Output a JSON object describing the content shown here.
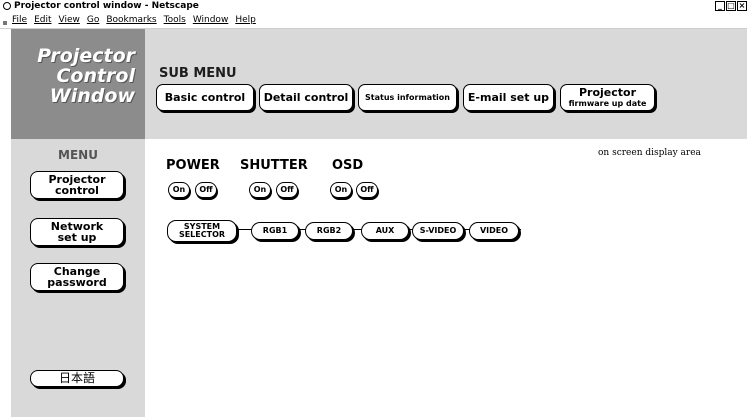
{
  "window": {
    "title": "Projector control window - Netscape",
    "controls": [
      "_",
      "□",
      "×"
    ]
  },
  "menubar": {
    "items": [
      "File",
      "Edit",
      "View",
      "Go",
      "Bookmarks",
      "Tools",
      "Window",
      "Help"
    ]
  },
  "logo": {
    "lines": [
      "Projector",
      "Control",
      "Window"
    ]
  },
  "submenu": {
    "title": "SUB MENU",
    "buttons": {
      "basic_control": "Basic control",
      "detail_control": "Detail control",
      "status_information": "Status information",
      "email_set_up": "E-mail set up",
      "firmware_line1": "Projector",
      "firmware_line2": "firmware up date"
    }
  },
  "menu": {
    "title": "MENU",
    "projector_control": [
      "Projector",
      "control"
    ],
    "network_set_up": [
      "Network",
      "set up"
    ],
    "change_password": [
      "Change",
      "password"
    ],
    "japanese": "日本語"
  },
  "content": {
    "osd_area": "on screen display area",
    "groups": {
      "power": {
        "label": "POWER",
        "on": "On",
        "off": "Off"
      },
      "shutter": {
        "label": "SHUTTER",
        "on": "On",
        "off": "Off"
      },
      "osd": {
        "label": "OSD",
        "on": "On",
        "off": "Off"
      }
    },
    "sources": {
      "system_selector": [
        "SYSTEM",
        "SELECTOR"
      ],
      "rgb1": "RGB1",
      "rgb2": "RGB2",
      "aux": "AUX",
      "s_video": "S-VIDEO",
      "video": "VIDEO"
    }
  }
}
